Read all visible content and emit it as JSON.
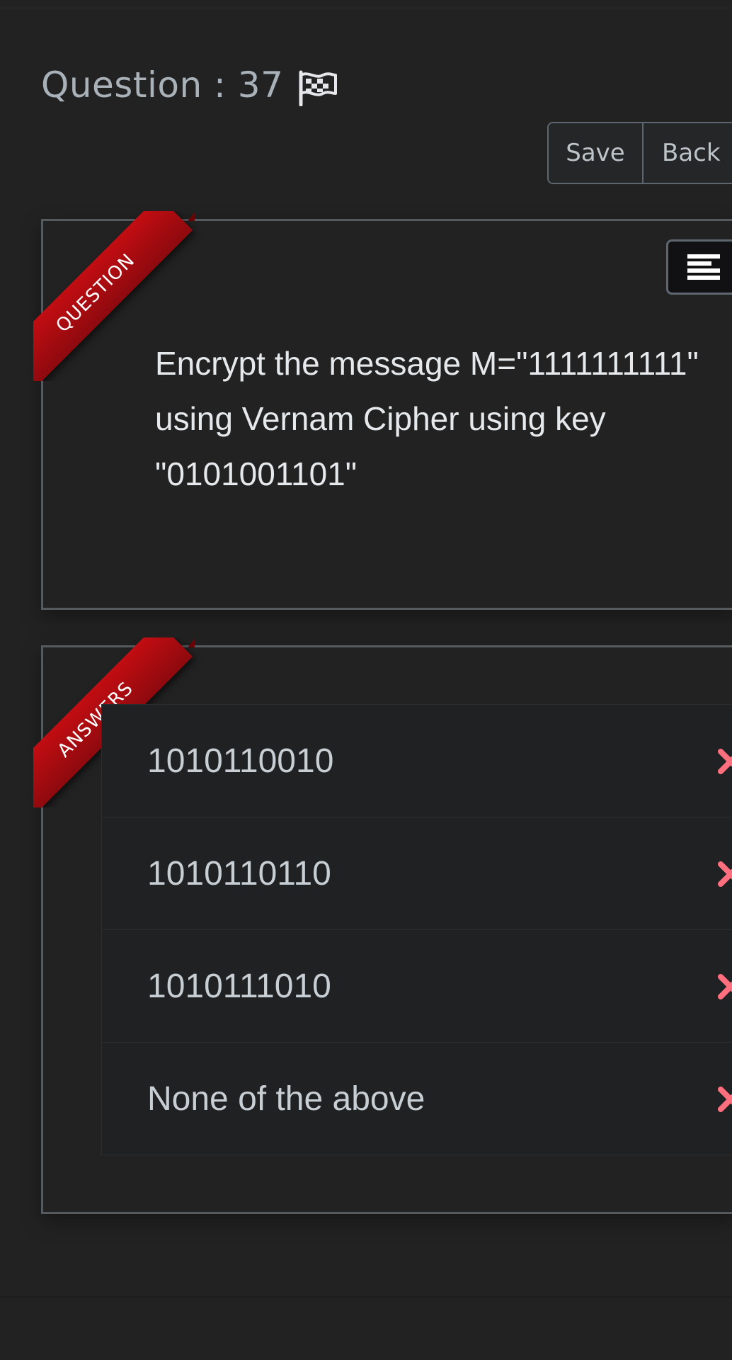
{
  "header": {
    "question_label": "Question : 37"
  },
  "toolbar": {
    "save_label": "Save",
    "back_label": "Back"
  },
  "question_panel": {
    "ribbon": "QUESTION",
    "text": "Encrypt the message M=\"1111111111\" using Vernam Cipher using key \"0101001101\""
  },
  "answers_panel": {
    "ribbon": "ANSWERS",
    "options": [
      {
        "label": "1010110010"
      },
      {
        "label": "1010110110"
      },
      {
        "label": "1010111010"
      },
      {
        "label": "None of the above"
      }
    ]
  },
  "icons": {
    "flag": "flag-icon",
    "align": "align-left-icon",
    "remove": "x-icon"
  },
  "colors": {
    "ribbon": "#b00d12",
    "x_mark": "#ff6f7e"
  }
}
